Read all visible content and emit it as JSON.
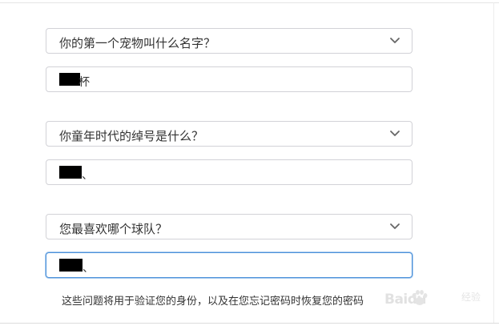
{
  "security_questions": [
    {
      "question": "你的第一个宠物叫什么名字？",
      "answer_suffix": "杯",
      "chevron_icon": "chevron-down-icon"
    },
    {
      "question": "你童年时代的绰号是什么？",
      "answer_suffix": "、",
      "chevron_icon": "chevron-down-icon"
    },
    {
      "question": "您最喜欢哪个球队？",
      "answer_suffix": "、",
      "chevron_icon": "chevron-down-icon"
    }
  ],
  "hint_text": "这些问题将用于验证您的身份，以及在您忘记密码时恢复您的密码",
  "watermark": {
    "brand": "Baidu",
    "sub": "经验"
  },
  "colors": {
    "border": "#d2d2d7",
    "focus_border": "#4a90d9",
    "text": "#333333",
    "redaction": "#000000"
  }
}
